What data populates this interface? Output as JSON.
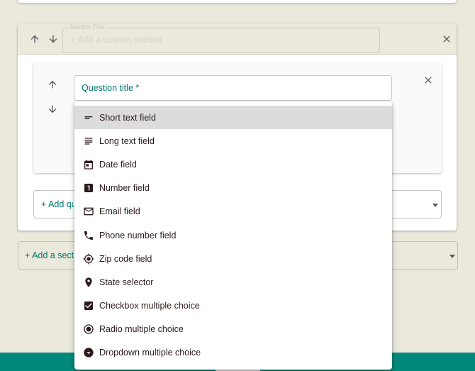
{
  "section": {
    "title_label": "Section Title",
    "title_placeholder": "+ Add a custom section"
  },
  "question": {
    "title_label": "Question title *"
  },
  "add_question_label": "+ Add qu",
  "add_section_label": "+ Add a sectio",
  "field_type_menu": {
    "selected": "Short text field",
    "items": [
      {
        "label": "Short text field",
        "icon": "short-text-icon"
      },
      {
        "label": "Long text field",
        "icon": "long-text-icon"
      },
      {
        "label": "Date field",
        "icon": "calendar-icon"
      },
      {
        "label": "Number field",
        "icon": "number-one-icon"
      },
      {
        "label": "Email field",
        "icon": "mail-icon"
      },
      {
        "label": "Phone number field",
        "icon": "phone-icon"
      },
      {
        "label": "Zip code field",
        "icon": "location-crosshair-icon"
      },
      {
        "label": "State selector",
        "icon": "map-pin-icon"
      },
      {
        "label": "Checkbox multiple choice",
        "icon": "checkbox-icon"
      },
      {
        "label": "Radio multiple choice",
        "icon": "radio-button-icon"
      },
      {
        "label": "Dropdown multiple choice",
        "icon": "dropdown-circle-icon"
      }
    ]
  },
  "colors": {
    "background": "#ebe8dc",
    "accent": "#00796b",
    "footer": "#00897b",
    "menu_text": "#2d1a1a"
  }
}
